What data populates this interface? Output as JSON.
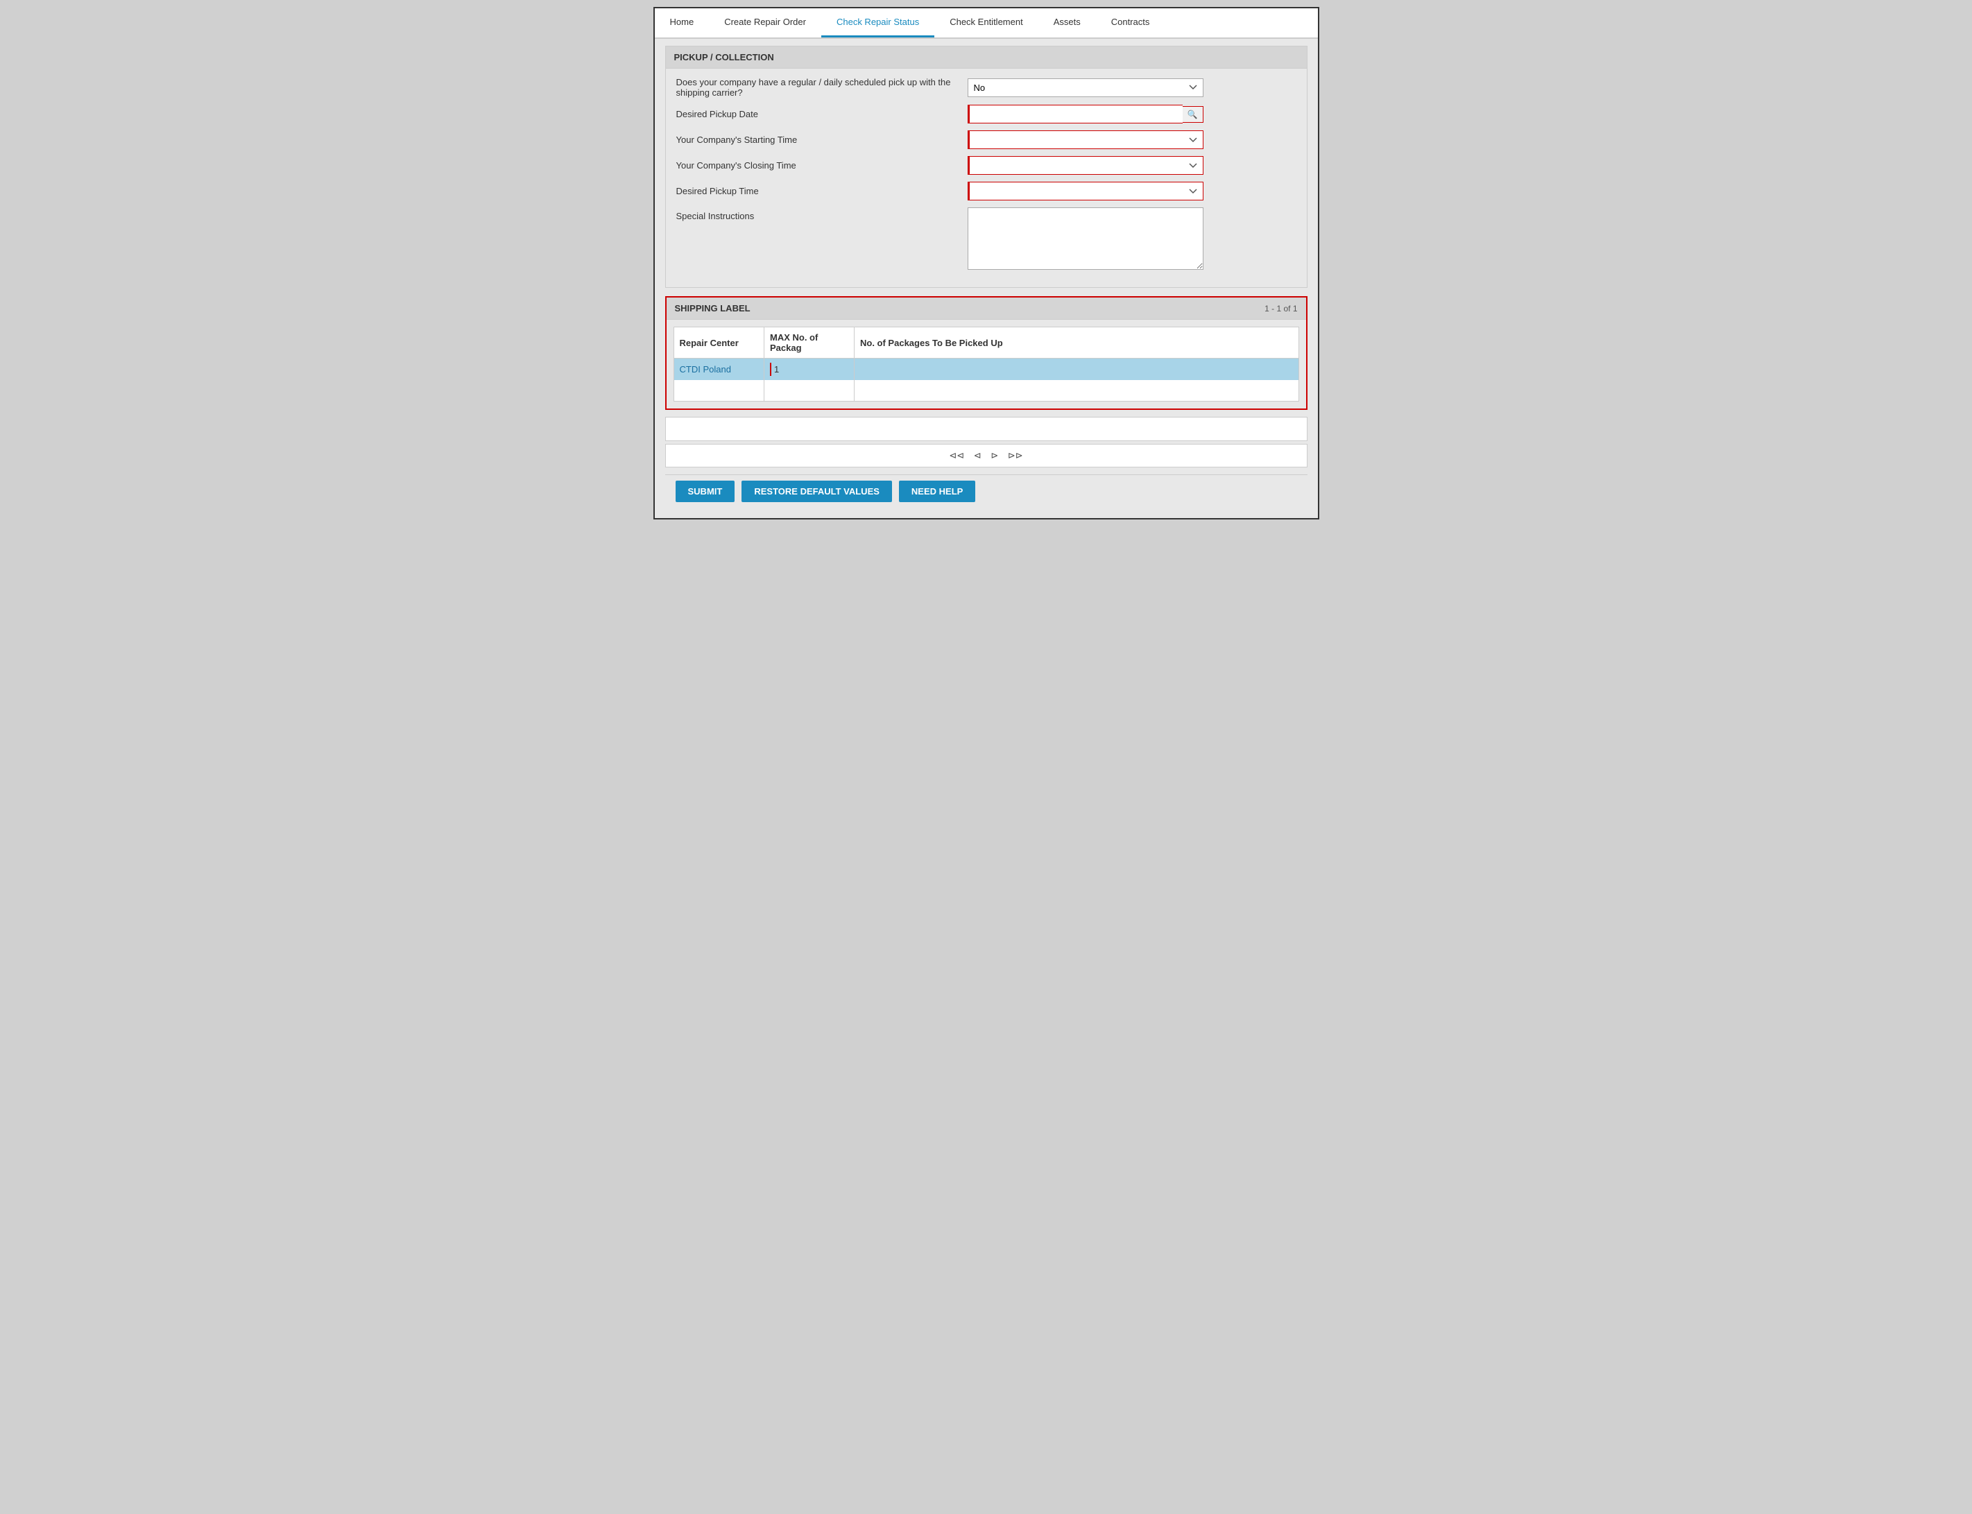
{
  "nav": {
    "items": [
      {
        "id": "home",
        "label": "Home",
        "active": false
      },
      {
        "id": "create-repair-order",
        "label": "Create Repair Order",
        "active": false
      },
      {
        "id": "check-repair-status",
        "label": "Check Repair Status",
        "active": true
      },
      {
        "id": "check-entitlement",
        "label": "Check Entitlement",
        "active": false
      },
      {
        "id": "assets",
        "label": "Assets",
        "active": false
      },
      {
        "id": "contracts",
        "label": "Contracts",
        "active": false
      }
    ]
  },
  "pickup_section": {
    "title": "PICKUP / COLLECTION",
    "fields": {
      "scheduled_pickup_label": "Does your company have a regular / daily scheduled pick up with the shipping carrier?",
      "scheduled_pickup_value": "No",
      "desired_pickup_date_label": "Desired Pickup Date",
      "starting_time_label": "Your Company's Starting Time",
      "closing_time_label": "Your Company's Closing Time",
      "desired_pickup_time_label": "Desired Pickup Time",
      "special_instructions_label": "Special Instructions"
    }
  },
  "shipping_label_section": {
    "title": "SHIPPING LABEL",
    "pagination": "1 - 1 of 1",
    "table": {
      "columns": [
        {
          "id": "repair-center",
          "label": "Repair Center"
        },
        {
          "id": "max-packages",
          "label": "MAX No. of Packag"
        },
        {
          "id": "no-packages",
          "label": "No. of Packages To Be Picked Up"
        }
      ],
      "rows": [
        {
          "repair_center": "CTDI Poland",
          "max_packages": "1",
          "no_packages": "",
          "selected": true
        }
      ]
    },
    "pagination_controls": {
      "first": "⊲⊲",
      "prev": "⊲",
      "next": "⊳",
      "last": "⊳⊳"
    }
  },
  "buttons": {
    "submit": "SUBMIT",
    "restore": "RESTORE DEFAULT VALUES",
    "help": "NEED HELP"
  }
}
